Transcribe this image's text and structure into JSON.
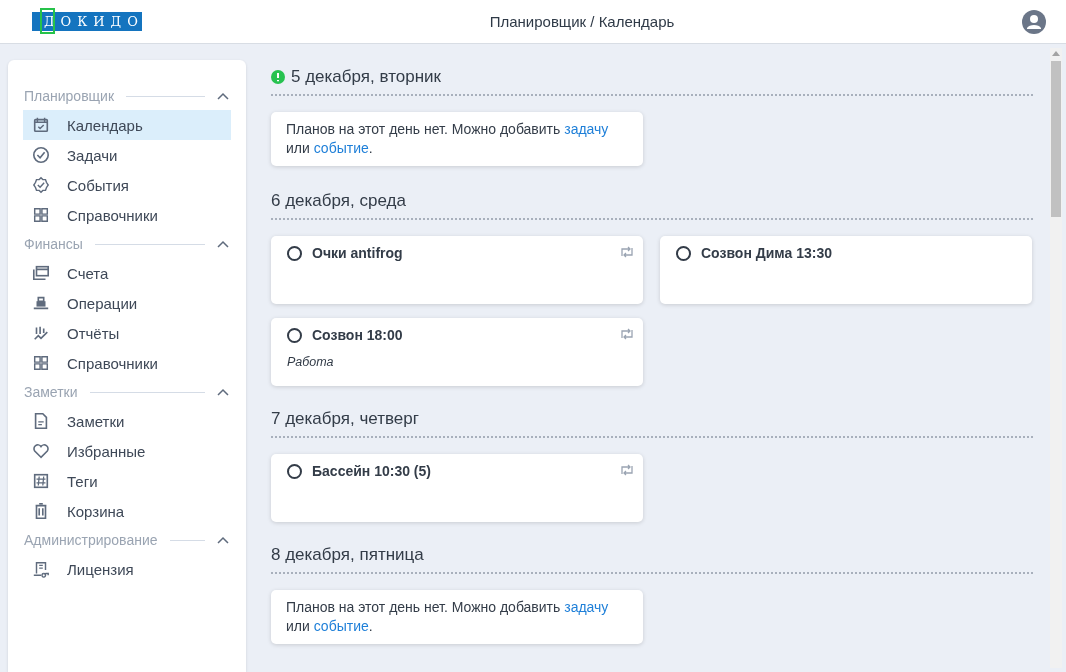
{
  "header": {
    "logo": "ДОКИДО",
    "title": "Планировщик / Календарь"
  },
  "sidebar": {
    "sections": [
      {
        "title": "Планировщик",
        "expanded": true,
        "items": [
          {
            "label": "Календарь",
            "selected": true
          },
          {
            "label": "Задачи",
            "selected": false
          },
          {
            "label": "События",
            "selected": false
          },
          {
            "label": "Справочники",
            "selected": false
          }
        ]
      },
      {
        "title": "Финансы",
        "expanded": true,
        "items": [
          {
            "label": "Счета",
            "selected": false
          },
          {
            "label": "Операции",
            "selected": false
          },
          {
            "label": "Отчёты",
            "selected": false
          },
          {
            "label": "Справочники",
            "selected": false
          }
        ]
      },
      {
        "title": "Заметки",
        "expanded": true,
        "items": [
          {
            "label": "Заметки",
            "selected": false
          },
          {
            "label": "Избранные",
            "selected": false
          },
          {
            "label": "Теги",
            "selected": false
          },
          {
            "label": "Корзина",
            "selected": false
          }
        ]
      },
      {
        "title": "Администрирование",
        "expanded": true,
        "items": [
          {
            "label": "Лицензия",
            "selected": false
          }
        ]
      }
    ]
  },
  "days": [
    {
      "title": "5 декабря, вторник",
      "alert": true,
      "kind": "empty",
      "message": {
        "text": "Планов на этот день нет. Можно добавить",
        "link_task": "задачу",
        "joiner": "или",
        "link_event": "событие",
        "end": "."
      }
    },
    {
      "title": "6 декабря, среда",
      "alert": false,
      "kind": "events",
      "events": [
        {
          "title": "Очки antifrog",
          "done": false,
          "recurring": true
        },
        {
          "title": "Созвон Дима 13:30",
          "done": false,
          "recurring": false
        },
        {
          "title": "Созвон 18:00",
          "done": false,
          "recurring": true,
          "category": "Работа"
        }
      ]
    },
    {
      "title": "7 декабря, четверг",
      "alert": false,
      "kind": "events",
      "events": [
        {
          "title": "Бассейн 10:30 (5)",
          "done": false,
          "recurring": true
        }
      ]
    },
    {
      "title": "8 декабря, пятница",
      "alert": false,
      "kind": "empty",
      "message": {
        "text": "Планов на этот день нет. Можно добавить",
        "link_task": "задачу",
        "joiner": "или",
        "link_event": "событие",
        "end": "."
      }
    }
  ]
}
